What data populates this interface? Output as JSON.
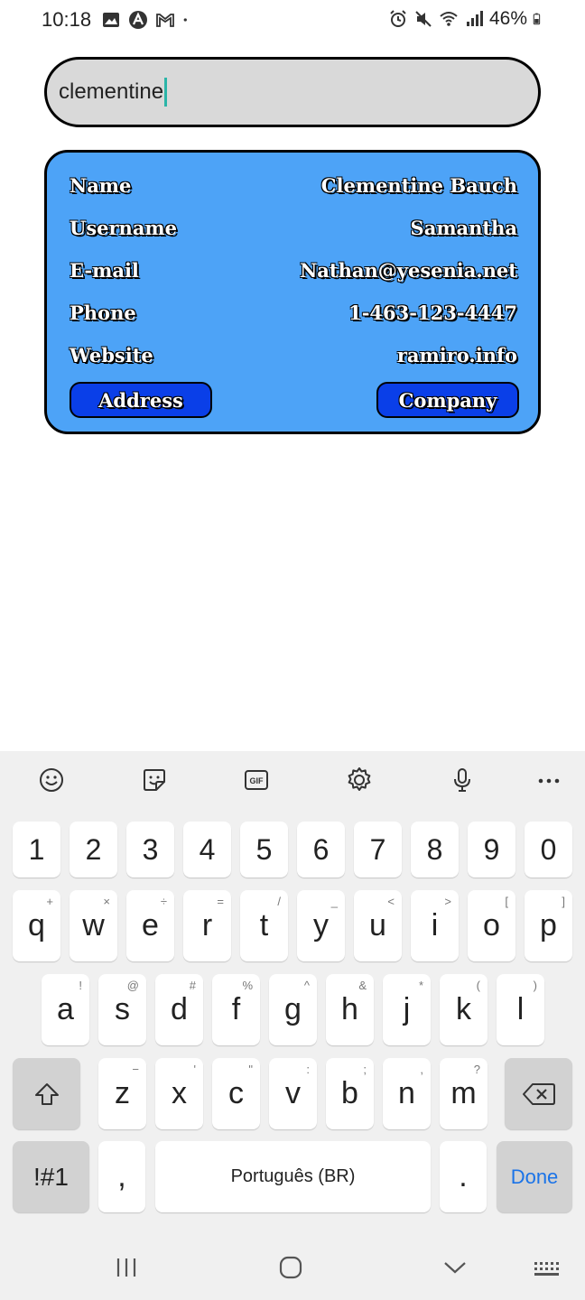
{
  "status_bar": {
    "time": "10:18",
    "battery": "46%",
    "icons_left": [
      "gallery-icon",
      "app-icon",
      "gmail-icon",
      "dot-icon"
    ],
    "icons_right": [
      "alarm-icon",
      "mute-icon",
      "wifi-icon",
      "signal-icon",
      "battery-icon"
    ]
  },
  "search": {
    "value": "clementine"
  },
  "card": {
    "rows": [
      {
        "label": "Name",
        "value": "Clementine Bauch"
      },
      {
        "label": "Username",
        "value": "Samantha"
      },
      {
        "label": "E-mail",
        "value": "Nathan@yesenia.net"
      },
      {
        "label": "Phone",
        "value": "1-463-123-4447"
      },
      {
        "label": "Website",
        "value": "ramiro.info"
      }
    ],
    "address_button": "Address",
    "company_button": "Company",
    "colors": {
      "card_bg": "#4da3f7",
      "button_bg": "#0a3fe8"
    }
  },
  "keyboard": {
    "toolbar": [
      "emoji-icon",
      "sticker-icon",
      "gif-icon",
      "settings-icon",
      "mic-icon",
      "more-icon"
    ],
    "number_row": [
      "1",
      "2",
      "3",
      "4",
      "5",
      "6",
      "7",
      "8",
      "9",
      "0"
    ],
    "row1": [
      {
        "k": "q",
        "h": "+"
      },
      {
        "k": "w",
        "h": "×"
      },
      {
        "k": "e",
        "h": "÷"
      },
      {
        "k": "r",
        "h": "="
      },
      {
        "k": "t",
        "h": "/"
      },
      {
        "k": "y",
        "h": "_"
      },
      {
        "k": "u",
        "h": "<"
      },
      {
        "k": "i",
        "h": ">"
      },
      {
        "k": "o",
        "h": "["
      },
      {
        "k": "p",
        "h": "]"
      }
    ],
    "row2": [
      {
        "k": "a",
        "h": "!"
      },
      {
        "k": "s",
        "h": "@"
      },
      {
        "k": "d",
        "h": "#"
      },
      {
        "k": "f",
        "h": "%"
      },
      {
        "k": "g",
        "h": "^"
      },
      {
        "k": "h",
        "h": "&"
      },
      {
        "k": "j",
        "h": "*"
      },
      {
        "k": "k",
        "h": "("
      },
      {
        "k": "l",
        "h": ")"
      }
    ],
    "row3": [
      {
        "k": "z",
        "h": "−"
      },
      {
        "k": "x",
        "h": "'"
      },
      {
        "k": "c",
        "h": "\""
      },
      {
        "k": "v",
        "h": ":"
      },
      {
        "k": "b",
        "h": ";"
      },
      {
        "k": "n",
        "h": ","
      },
      {
        "k": "m",
        "h": "?"
      }
    ],
    "symbols_key": "!#1",
    "comma_key": ",",
    "space_label": "Português (BR)",
    "period_key": ".",
    "done_label": "Done",
    "accent_color": "#1a73e8"
  },
  "nav": [
    "recents-icon",
    "home-icon",
    "back-icon",
    "keyboard-switch-icon"
  ]
}
